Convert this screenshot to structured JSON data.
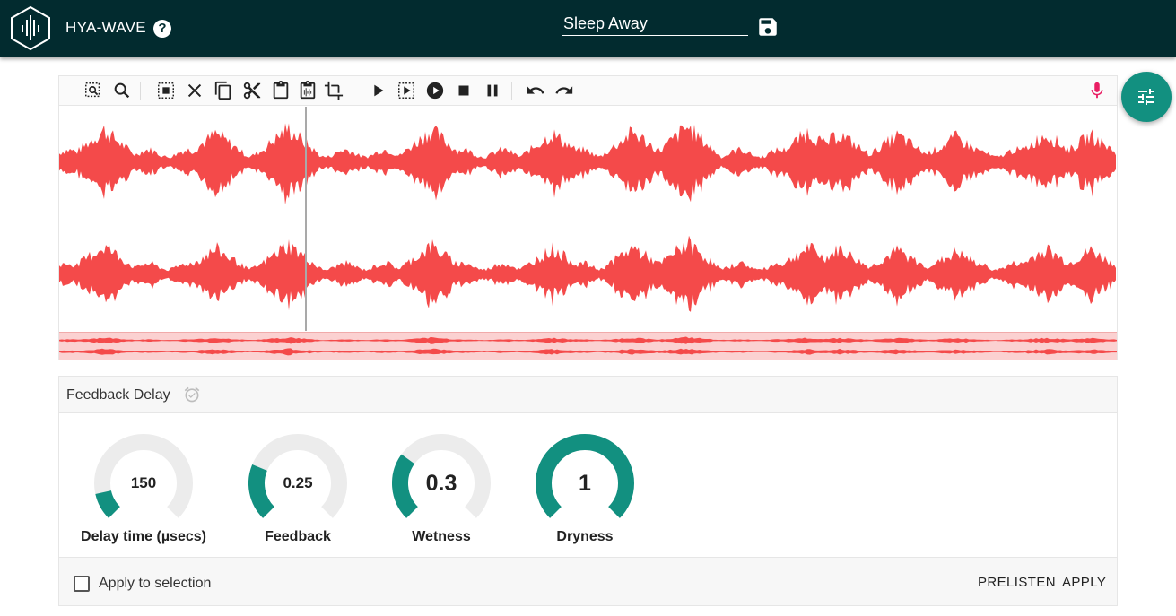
{
  "header": {
    "brand": "HYA-WAVE",
    "help_symbol": "?",
    "track_title": "Sleep Away"
  },
  "toolbar": {
    "icons": [
      "select-zoom-icon",
      "zoom-icon",
      "select-all-icon",
      "close-icon",
      "copy-icon",
      "cut-icon",
      "paste-icon",
      "paste-special-icon",
      "crop-icon",
      "play-icon",
      "play-selection-icon",
      "play-circle-icon",
      "stop-icon",
      "pause-icon",
      "undo-icon",
      "redo-icon",
      "microphone-icon"
    ]
  },
  "colors": {
    "appbar": "#022b2f",
    "waveform": "#f44a4a",
    "overview_bg": "#fbd1d1",
    "accent": "#129080",
    "mic": "#e91e63",
    "knob_track": "#ececec"
  },
  "effect": {
    "title": "Feedback Delay",
    "knobs": [
      {
        "label": "Delay time (µsecs)",
        "value": "150",
        "fraction": 0.12
      },
      {
        "label": "Feedback",
        "value": "0.25",
        "fraction": 0.25
      },
      {
        "label": "Wetness",
        "value": "0.3",
        "fraction": 0.3
      },
      {
        "label": "Dryness",
        "value": "1",
        "fraction": 1.0
      }
    ],
    "apply_to_selection_label": "Apply to selection",
    "apply_to_selection_checked": false,
    "prelisten_label": "PRELISTEN",
    "apply_label": "APPLY"
  }
}
